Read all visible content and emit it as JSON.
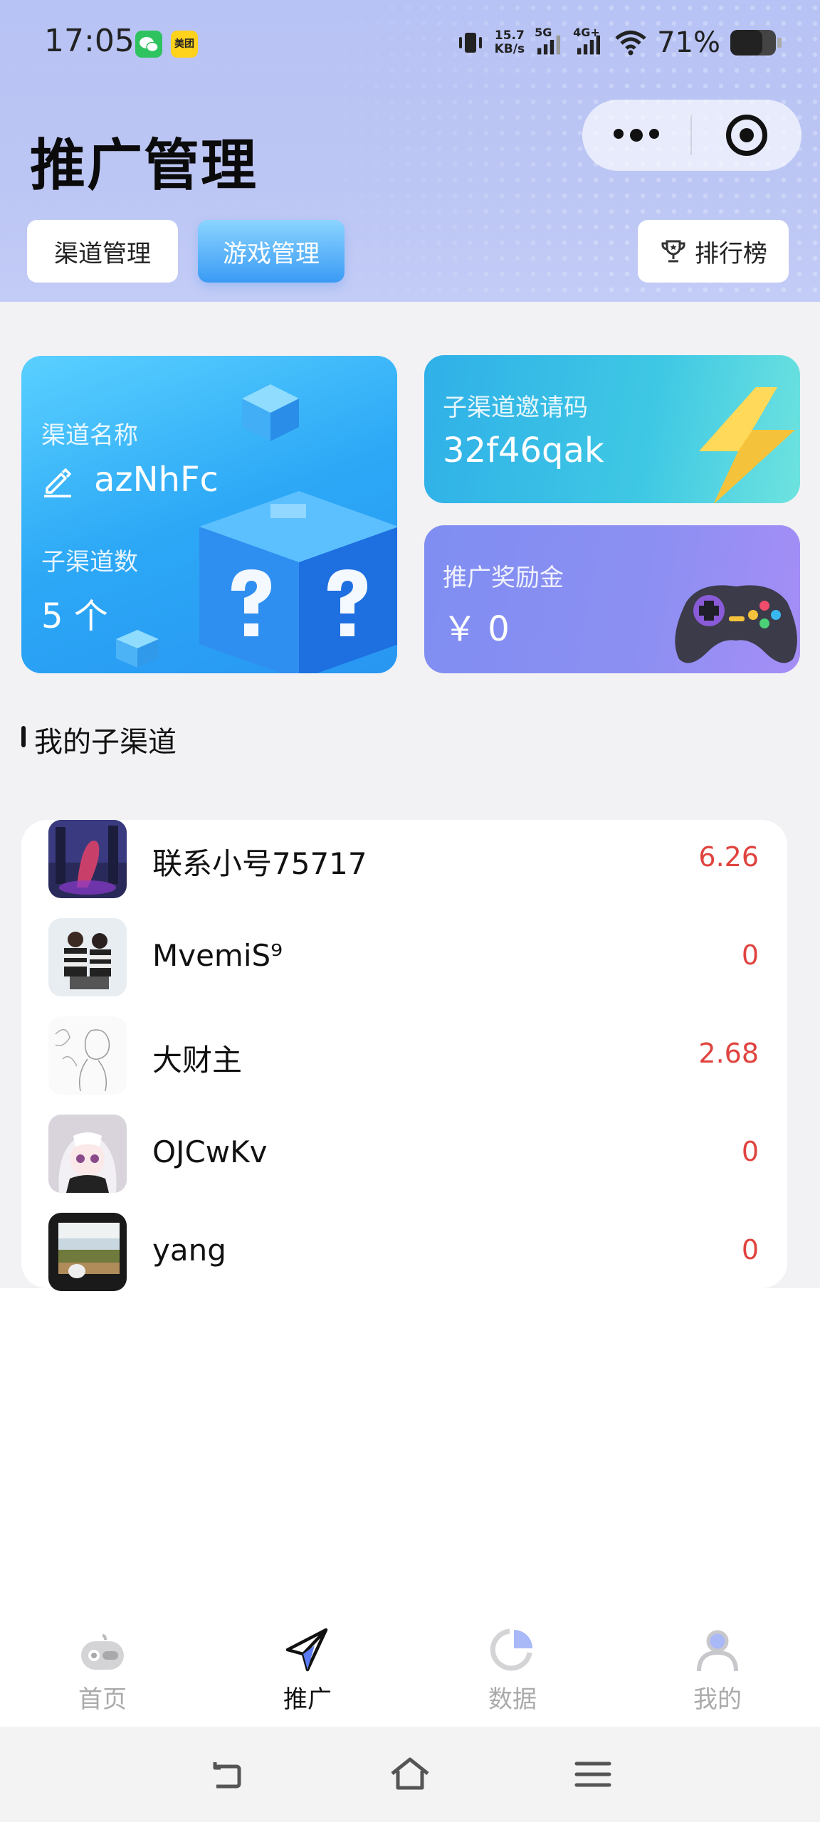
{
  "status_bar": {
    "time": "17:05",
    "wechat_icon": "wechat-icon",
    "meituan_label": "美团",
    "net_speed_value": "15.7",
    "net_speed_unit": "KB/s",
    "network_5g": "5G",
    "network_4g": "4G+",
    "battery_percent": "71%",
    "battery_level": 0.71
  },
  "header": {
    "title": "推广管理",
    "tabs": [
      {
        "label": "渠道管理",
        "active": false
      },
      {
        "label": "游戏管理",
        "active": true
      }
    ],
    "ranking_label": "排行榜"
  },
  "cards": {
    "channel_name_label": "渠道名称",
    "channel_name_value": "azNhFc",
    "sub_channel_count_label": "子渠道数",
    "sub_channel_count_value": "5 个",
    "invite_code_label": "子渠道邀请码",
    "invite_code_value": "32f46qak",
    "reward_label": "推广奖励金",
    "reward_value": "￥ 0"
  },
  "section": {
    "title": "我的子渠道"
  },
  "sub_channels": [
    {
      "name": "联系小号75717",
      "amount": "6.26"
    },
    {
      "name": "MvemiS⁹",
      "amount": "0"
    },
    {
      "name": "大财主",
      "amount": "2.68"
    },
    {
      "name": "OJCwKv",
      "amount": "0"
    },
    {
      "name": "yang",
      "amount": "0"
    }
  ],
  "tabbar": [
    {
      "label": "首页",
      "icon": "gamepad-icon",
      "active": false
    },
    {
      "label": "推广",
      "icon": "paper-plane-icon",
      "active": true
    },
    {
      "label": "数据",
      "icon": "pie-chart-icon",
      "active": false
    },
    {
      "label": "我的",
      "icon": "user-icon",
      "active": false
    }
  ],
  "colors": {
    "header_bg": "#b8c3f5",
    "accent_blue": "#3a9bf5",
    "amount_red": "#e0433f",
    "reward_purple": "#8d8ff2",
    "code_teal": "#3fc8e4"
  }
}
